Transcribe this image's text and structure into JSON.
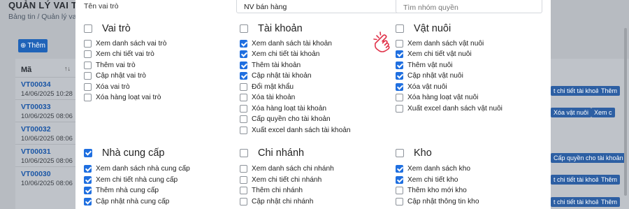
{
  "background": {
    "page_title": "QUẢN LÝ VAI TRÒ",
    "breadcrumb": [
      "Bảng tin",
      "Quản lý vai trò"
    ],
    "add_button": "Thêm",
    "table_header": "Mã",
    "rows": [
      {
        "code": "VT00034",
        "date": "14/06/2025 10:28"
      },
      {
        "code": "VT00033",
        "date": "10/06/2025 08:06"
      },
      {
        "code": "VT00032",
        "date": "10/06/2025 08:06"
      },
      {
        "code": "VT00031",
        "date": "10/06/2025 08:06"
      },
      {
        "code": "VT00030",
        "date": "10/06/2025 08:06"
      }
    ],
    "chips": [
      "t chi tiết tài khoản",
      "Thêm",
      "Xóa vật nuôi",
      "Xem c",
      "Cấp quyền cho tài khoản",
      "t chi tiết tài khoản",
      "Thêm",
      "t chi tiết tài khoản",
      "Thêm"
    ]
  },
  "modal": {
    "role_name_label": "Tên vai trò",
    "role_name_value": "NV bán hàng",
    "group_search_placeholder": "Tìm nhóm quyền",
    "groups": [
      {
        "title": "Vai trò",
        "checked": false,
        "items": [
          {
            "label": "Xem danh sách vai trò",
            "checked": false
          },
          {
            "label": "Xem chi tiết vai trò",
            "checked": false
          },
          {
            "label": "Thêm vai trò",
            "checked": false
          },
          {
            "label": "Cập nhật vai trò",
            "checked": false
          },
          {
            "label": "Xóa vai trò",
            "checked": false
          },
          {
            "label": "Xóa hàng loạt vai trò",
            "checked": false
          }
        ]
      },
      {
        "title": "Tài khoản",
        "checked": false,
        "items": [
          {
            "label": "Xem danh sách tài khoản",
            "checked": true
          },
          {
            "label": "Xem chi tiết tài khoản",
            "checked": true
          },
          {
            "label": "Thêm tài khoản",
            "checked": true
          },
          {
            "label": "Cập nhật tài khoản",
            "checked": true
          },
          {
            "label": "Đổi mật khẩu",
            "checked": false
          },
          {
            "label": "Xóa tài khoản",
            "checked": false
          },
          {
            "label": "Xóa hàng loạt tài khoản",
            "checked": false
          },
          {
            "label": "Cấp quyền cho tài khoản",
            "checked": false
          },
          {
            "label": "Xuất excel danh sách tài khoản",
            "checked": false
          }
        ]
      },
      {
        "title": "Vật nuôi",
        "checked": false,
        "items": [
          {
            "label": "Xem danh sách vật nuôi",
            "checked": false
          },
          {
            "label": "Xem chi tiết vật nuôi",
            "checked": true
          },
          {
            "label": "Thêm vật nuôi",
            "checked": true
          },
          {
            "label": "Cập nhật vật nuôi",
            "checked": true
          },
          {
            "label": "Xóa vật nuôi",
            "checked": true
          },
          {
            "label": "Xóa hàng loạt vật nuôi",
            "checked": false
          },
          {
            "label": "Xuất excel danh sách vật nuôi",
            "checked": false
          }
        ]
      },
      {
        "title": "Nhà cung cấp",
        "checked": true,
        "items": [
          {
            "label": "Xem danh sách nhà cung cấp",
            "checked": true
          },
          {
            "label": "Xem chi tiết nhà cung cấp",
            "checked": true
          },
          {
            "label": "Thêm nhà cung cấp",
            "checked": true
          },
          {
            "label": "Cập nhật nhà cung cấp",
            "checked": true
          }
        ]
      },
      {
        "title": "Chi nhánh",
        "checked": false,
        "items": [
          {
            "label": "Xem danh sách chi nhánh",
            "checked": false
          },
          {
            "label": "Xem chi tiết chi nhánh",
            "checked": false
          },
          {
            "label": "Thêm chi nhánh",
            "checked": false
          },
          {
            "label": "Cập nhật chi nhánh",
            "checked": false
          }
        ]
      },
      {
        "title": "Kho",
        "checked": false,
        "items": [
          {
            "label": "Xem danh sách kho",
            "checked": true
          },
          {
            "label": "Xem chi tiết kho",
            "checked": true
          },
          {
            "label": "Thêm kho mới kho",
            "checked": false
          },
          {
            "label": "Cập nhật thông tin kho",
            "checked": false
          }
        ]
      }
    ],
    "cursor_icon": "hand-pointer-icon"
  }
}
